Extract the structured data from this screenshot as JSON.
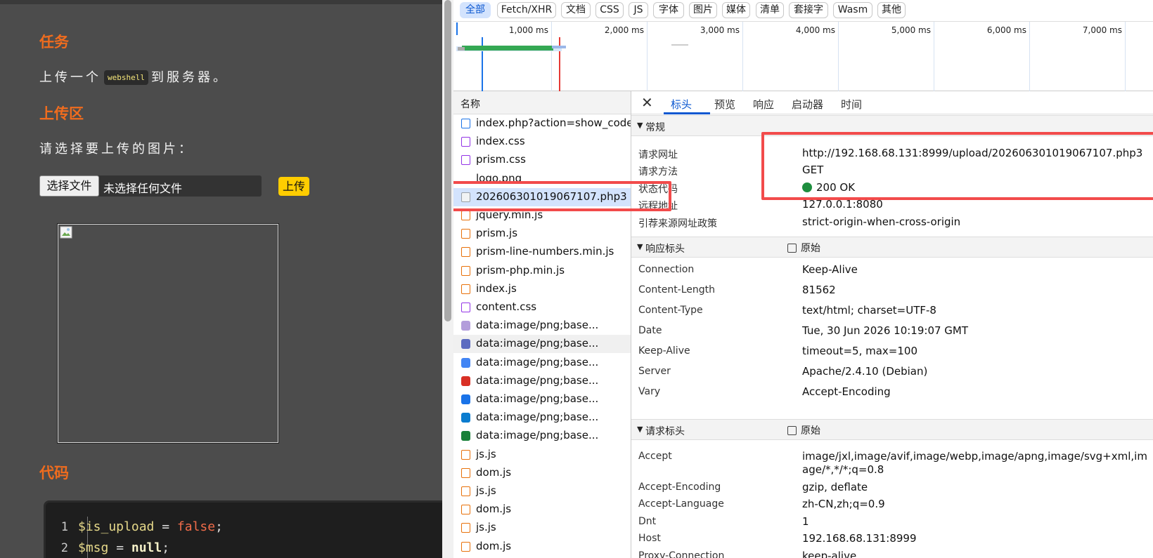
{
  "page": {
    "task_heading": "任务",
    "task_text_before": "上传一个",
    "task_code": "webshell",
    "task_text_after": "到服务器。",
    "upload_heading": "上传区",
    "choose_prompt": "请选择要上传的图片：",
    "choose_button": "选择文件",
    "file_status": "未选择任何文件",
    "upload_button": "上传",
    "code_heading": "代码",
    "code_lines": [
      {
        "num": "1",
        "var": "$is_upload",
        "op": " = ",
        "val": "false",
        "end": ";"
      },
      {
        "num": "2",
        "var": "$msg",
        "op": " = ",
        "val": "null",
        "end": ";"
      }
    ]
  },
  "devtools": {
    "filters": [
      "全部",
      "Fetch/XHR",
      "文档",
      "CSS",
      "JS",
      "字体",
      "图片",
      "媒体",
      "清单",
      "套接字",
      "Wasm",
      "其他"
    ],
    "active_filter": "全部",
    "timeline_ticks": [
      "1,000 ms",
      "2,000 ms",
      "3,000 ms",
      "4,000 ms",
      "5,000 ms",
      "6,000 ms",
      "7,000 ms"
    ],
    "name_header": "名称",
    "requests": [
      {
        "name": "index.php?action=show_code",
        "type": "doc"
      },
      {
        "name": "index.css",
        "type": "css"
      },
      {
        "name": "prism.css",
        "type": "css"
      },
      {
        "name": "logo.png",
        "type": "png"
      },
      {
        "name": "202606301019067107.php3",
        "type": "img",
        "selected": true
      },
      {
        "name": "jquery.min.js",
        "type": "js"
      },
      {
        "name": "prism.js",
        "type": "js"
      },
      {
        "name": "prism-line-numbers.min.js",
        "type": "js"
      },
      {
        "name": "prism-php.min.js",
        "type": "js"
      },
      {
        "name": "index.js",
        "type": "js"
      },
      {
        "name": "content.css",
        "type": "css"
      },
      {
        "name": "data:image/png;base...",
        "type": "ext1"
      },
      {
        "name": "data:image/png;base...",
        "type": "ext2",
        "hover": true
      },
      {
        "name": "data:image/png;base...",
        "type": "ext3"
      },
      {
        "name": "data:image/png;base...",
        "type": "ext4"
      },
      {
        "name": "data:image/png;base...",
        "type": "ext5"
      },
      {
        "name": "data:image/png;base...",
        "type": "ext6"
      },
      {
        "name": "data:image/png;base...",
        "type": "ext7"
      },
      {
        "name": "js.js",
        "type": "js"
      },
      {
        "name": "dom.js",
        "type": "js"
      },
      {
        "name": "js.js",
        "type": "js"
      },
      {
        "name": "dom.js",
        "type": "js"
      },
      {
        "name": "js.js",
        "type": "js"
      },
      {
        "name": "dom.js",
        "type": "js"
      }
    ],
    "tabs": [
      "标头",
      "预览",
      "响应",
      "启动器",
      "时间"
    ],
    "active_tab": "标头",
    "general": {
      "title": "常规",
      "rows": [
        {
          "key": "请求网址",
          "value": "http://192.168.68.131:8999/upload/202606301019067107.php3"
        },
        {
          "key": "请求方法",
          "value": "GET"
        },
        {
          "key": "状态代码",
          "value": "200 OK"
        },
        {
          "key": "远程地址",
          "value": "127.0.0.1:8080"
        },
        {
          "key": "引荐来源网址政策",
          "value": "strict-origin-when-cross-origin"
        }
      ]
    },
    "response_headers": {
      "title": "响应标头",
      "raw_label": "原始",
      "rows": [
        {
          "key": "Connection",
          "value": "Keep-Alive"
        },
        {
          "key": "Content-Length",
          "value": "81562"
        },
        {
          "key": "Content-Type",
          "value": "text/html; charset=UTF-8"
        },
        {
          "key": "Date",
          "value": "Tue, 30 Jun 2026 10:19:07 GMT"
        },
        {
          "key": "Keep-Alive",
          "value": "timeout=5, max=100"
        },
        {
          "key": "Server",
          "value": "Apache/2.4.10 (Debian)"
        },
        {
          "key": "Vary",
          "value": "Accept-Encoding"
        }
      ]
    },
    "request_headers": {
      "title": "请求标头",
      "raw_label": "原始",
      "rows": [
        {
          "key": "Accept",
          "value": "image/jxl,image/avif,image/webp,image/apng,image/svg+xml,image/*,*/*;q=0.8"
        },
        {
          "key": "Accept-Encoding",
          "value": "gzip, deflate"
        },
        {
          "key": "Accept-Language",
          "value": "zh-CN,zh;q=0.9"
        },
        {
          "key": "Dnt",
          "value": "1"
        },
        {
          "key": "Host",
          "value": "192.168.68.131:8999"
        },
        {
          "key": "Proxy-Connection",
          "value": "keep-alive"
        }
      ]
    }
  }
}
